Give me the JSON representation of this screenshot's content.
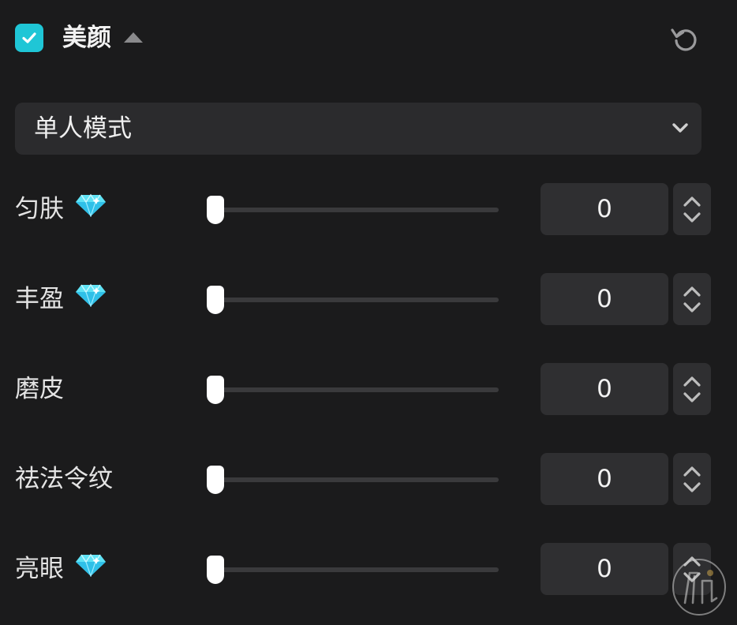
{
  "header": {
    "title": "美颜",
    "checked": true,
    "icons": {
      "checkbox": "check-icon",
      "collapse": "triangle-up-icon",
      "reset": "reset-icon"
    }
  },
  "mode_select": {
    "value": "单人模式",
    "icon": "chevron-down-icon"
  },
  "sliders": [
    {
      "label": "匀肤",
      "premium": true,
      "value": "0",
      "fraction": 0
    },
    {
      "label": "丰盈",
      "premium": true,
      "value": "0",
      "fraction": 0
    },
    {
      "label": "磨皮",
      "premium": false,
      "value": "0",
      "fraction": 0
    },
    {
      "label": "祛法令纹",
      "premium": false,
      "value": "0",
      "fraction": 0
    },
    {
      "label": "亮眼",
      "premium": true,
      "value": "0",
      "fraction": 0
    }
  ],
  "colors": {
    "accent": "#1fc6d6",
    "background": "#1b1b1c",
    "gem": "#5fe3f5"
  }
}
